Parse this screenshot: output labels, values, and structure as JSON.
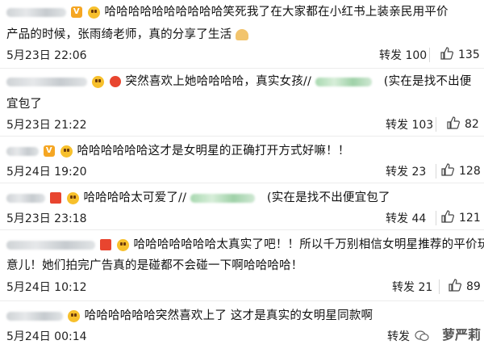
{
  "comments": [
    {
      "text_line1": "哈哈哈哈哈哈哈哈哈哈笑死我了在大家都在小红书上装亲民用平价",
      "text_line2": "产品的时候，张雨绮老师，真的分享了生活",
      "date": "5月23日 22:06",
      "repost_label": "转发 100",
      "like_count": "135"
    },
    {
      "text_line1": "突然喜欢上她哈哈哈哈，真实女孩//",
      "text_line1_tail": "(实在是找不出便",
      "text_line2": "宜包了",
      "date": "5月23日 21:22",
      "repost_label": "转发 103",
      "like_count": "82"
    },
    {
      "text_line1": "哈哈哈哈哈哈这才是女明星的正确打开方式好嘛！！",
      "date": "5月24日 19:20",
      "repost_label": "转发 23",
      "like_count": "128"
    },
    {
      "text_line1": "哈哈哈哈太可爱了//",
      "text_line1_tail": "(实在是找不出便宜包了",
      "date": "5月23日 23:18",
      "repost_label": "转发 44",
      "like_count": "121"
    },
    {
      "text_line1": "哈哈哈哈哈哈哈太真实了吧！！所以千万别相信女明星推荐的平价玩",
      "text_line2": "意儿！她们拍完广告真的是碰都不会碰一下啊哈哈哈哈！",
      "date": "5月24日 10:12",
      "repost_label": "转发 21",
      "like_count": "89"
    },
    {
      "text_line1": "哈哈哈哈哈哈突然喜欢上了 这才是真实的女明星同款啊",
      "date": "5月24日 00:14",
      "repost_label": "转发"
    }
  ],
  "watermark": "萝严莉",
  "colors": {
    "accent_badge": "#f5a623",
    "red_badge": "#e8452f",
    "divider": "#ececec"
  },
  "icons": {
    "like": "thumbs-up-icon",
    "emoji": "laughing-face-icon",
    "wechat": "wechat-icon"
  }
}
